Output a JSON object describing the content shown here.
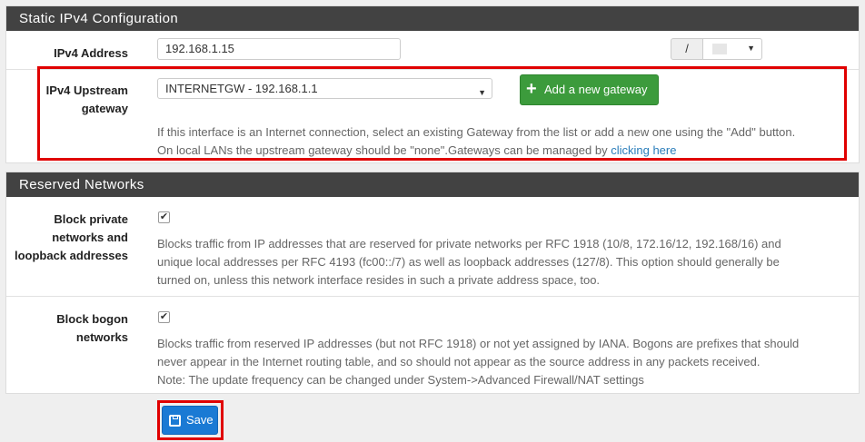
{
  "ipv4_panel": {
    "title": "Static IPv4 Configuration",
    "address": {
      "label": "IPv4 Address",
      "value": "192.168.1.15",
      "slash": "/",
      "cidr_value": ""
    },
    "gateway": {
      "label_line1": "IPv4 Upstream",
      "label_line2": "gateway",
      "selected": "INTERNETGW - 192.168.1.1",
      "add_button": "Add a new gateway",
      "help_line1": "If this interface is an Internet connection, select an existing Gateway from the list or add a new one using the \"Add\" button.",
      "help_line2_pre": "On local LANs the upstream gateway should be \"none\".Gateways can be managed by ",
      "help_link": "clicking here"
    }
  },
  "reserved_panel": {
    "title": "Reserved Networks",
    "private": {
      "label_line1": "Block private",
      "label_line2": "networks and",
      "label_line3": "loopback addresses",
      "checked": true,
      "help_line1": "Blocks traffic from IP addresses that are reserved for private networks per RFC 1918 (10/8, 172.16/12, 192.168/16) and",
      "help_line2": "unique local addresses per RFC 4193 (fc00::/7) as well as loopback addresses (127/8). This option should generally be",
      "help_line3": "turned on, unless this network interface resides in such a private address space, too."
    },
    "bogon": {
      "label_line1": "Block bogon",
      "label_line2": "networks",
      "checked": true,
      "help_line1": "Blocks traffic from reserved IP addresses (but not RFC 1918) or not yet assigned by IANA. Bogons are prefixes that should",
      "help_line2": "never appear in the Internet routing table, and so should not appear as the source address in any packets received.",
      "help_line3": "Note: The update frequency can be changed under System->Advanced Firewall/NAT settings"
    }
  },
  "save_button": "Save",
  "colors": {
    "panel_header": "#424242",
    "highlight": "#e00000",
    "add_button": "#3c9b3c",
    "save_button": "#1a7ad4",
    "link": "#2a7dba"
  },
  "icons": {
    "checkbox": "check-mark",
    "add": "plus-icon",
    "save": "floppy-disk-icon",
    "dropdown": "caret-down-icon"
  }
}
